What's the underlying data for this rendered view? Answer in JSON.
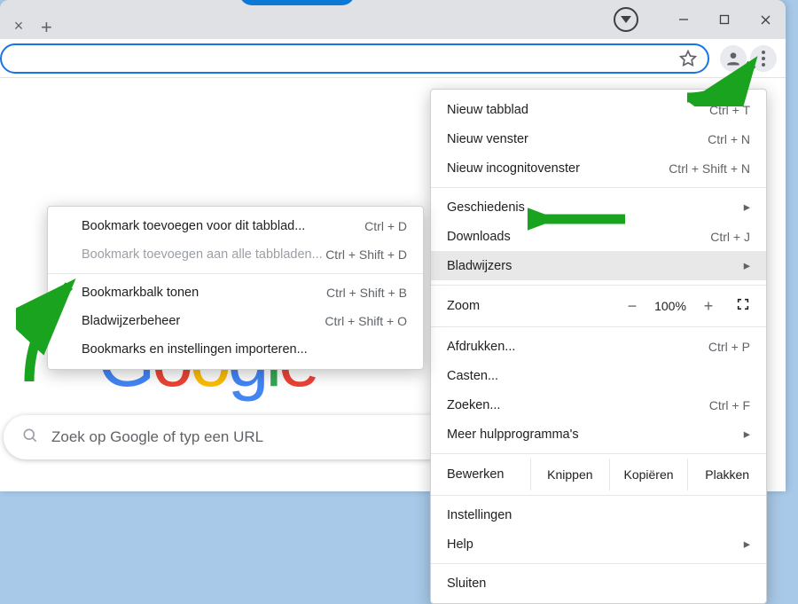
{
  "titlebar": {
    "close_tab": "×",
    "new_tab": "+"
  },
  "omnibox": {
    "star_title": "Bookmark"
  },
  "menu": {
    "new_tab": {
      "label": "Nieuw tabblad",
      "shortcut": "Ctrl + T"
    },
    "new_window": {
      "label": "Nieuw venster",
      "shortcut": "Ctrl + N"
    },
    "new_incognito": {
      "label": "Nieuw incognitovenster",
      "shortcut": "Ctrl + Shift + N"
    },
    "history": {
      "label": "Geschiedenis"
    },
    "downloads": {
      "label": "Downloads",
      "shortcut": "Ctrl + J"
    },
    "bookmarks": {
      "label": "Bladwijzers"
    },
    "zoom": {
      "label": "Zoom",
      "value": "100%"
    },
    "print": {
      "label": "Afdrukken...",
      "shortcut": "Ctrl + P"
    },
    "cast": {
      "label": "Casten..."
    },
    "find": {
      "label": "Zoeken...",
      "shortcut": "Ctrl + F"
    },
    "more_tools": {
      "label": "Meer hulpprogramma's"
    },
    "edit": {
      "label": "Bewerken",
      "cut": "Knippen",
      "copy": "Kopiëren",
      "paste": "Plakken"
    },
    "settings": {
      "label": "Instellingen"
    },
    "help": {
      "label": "Help"
    },
    "exit": {
      "label": "Sluiten"
    }
  },
  "submenu": {
    "bookmark_tab": {
      "label": "Bookmark toevoegen voor dit tabblad...",
      "shortcut": "Ctrl + D"
    },
    "bookmark_all": {
      "label": "Bookmark toevoegen aan alle tabbladen...",
      "shortcut": "Ctrl + Shift + D"
    },
    "show_bar": {
      "label": "Bookmarkbalk tonen",
      "shortcut": "Ctrl + Shift + B",
      "checked": true
    },
    "manager": {
      "label": "Bladwijzerbeheer",
      "shortcut": "Ctrl + Shift + O"
    },
    "import": {
      "label": "Bookmarks en instellingen importeren..."
    }
  },
  "search": {
    "placeholder": "Zoek op Google of typ een URL"
  },
  "logo": "Google"
}
